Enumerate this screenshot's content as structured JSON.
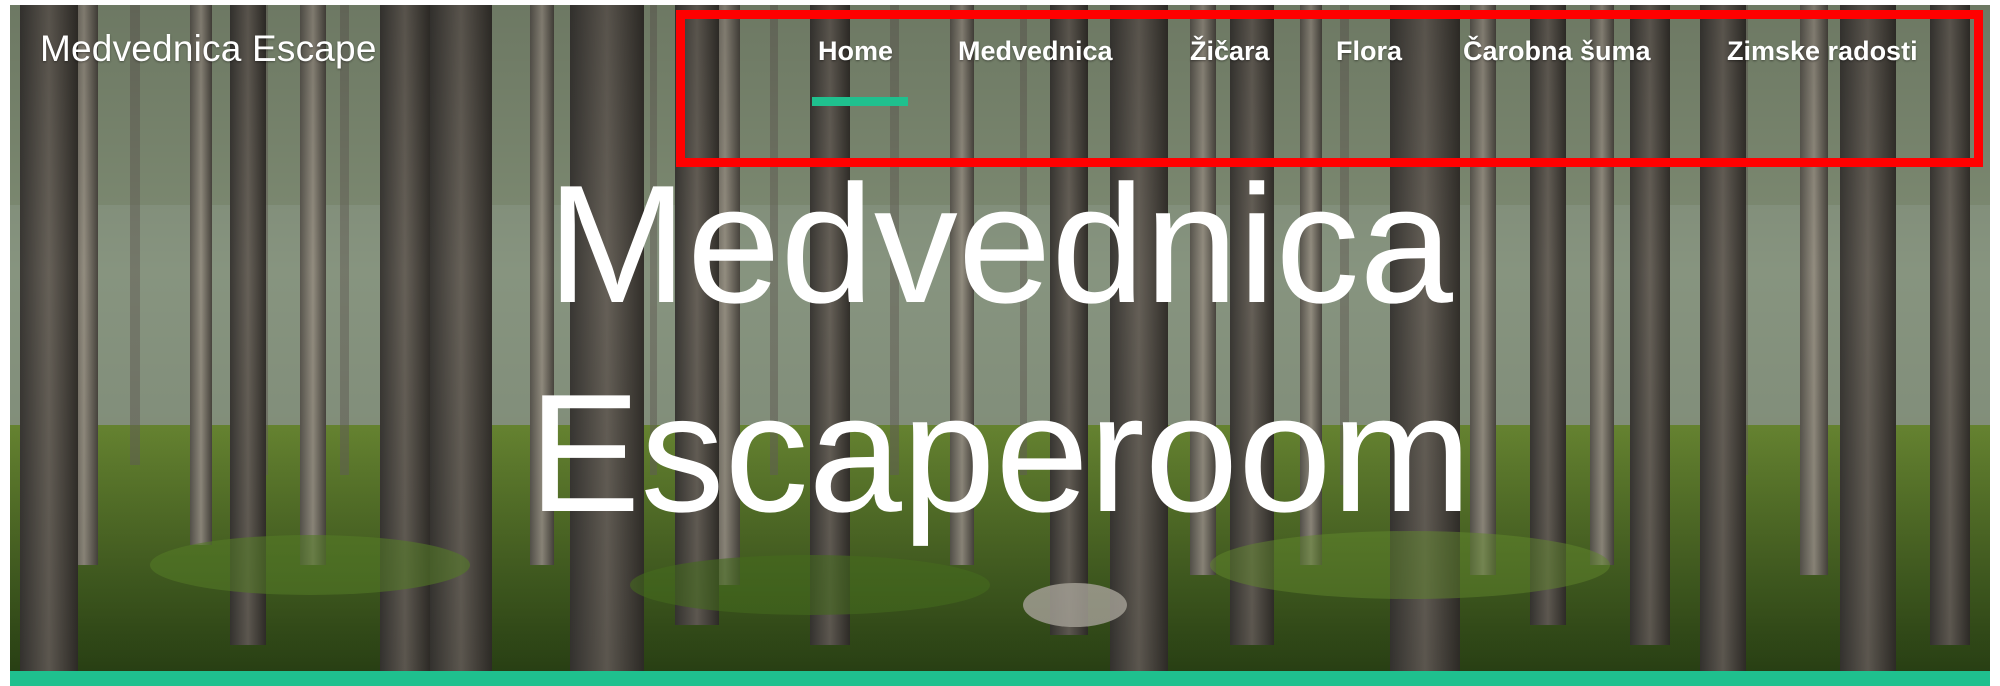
{
  "brand": {
    "name": "Medvednica Escape"
  },
  "nav": {
    "items": [
      {
        "label": "Home",
        "active": true
      },
      {
        "label": "Medvednica",
        "active": false
      },
      {
        "label": "Žičara",
        "active": false
      },
      {
        "label": "Flora",
        "active": false
      },
      {
        "label": "Čarobna šuma",
        "active": false
      },
      {
        "label": "Zimske radosti",
        "active": false
      }
    ],
    "highlight_color": "#ff0000",
    "active_underline_color": "#1fc08e"
  },
  "hero": {
    "title_line1": "Medvednica",
    "title_line2": "Escaperoom",
    "background": "forest-photo"
  },
  "accent_color": "#1fc08e"
}
